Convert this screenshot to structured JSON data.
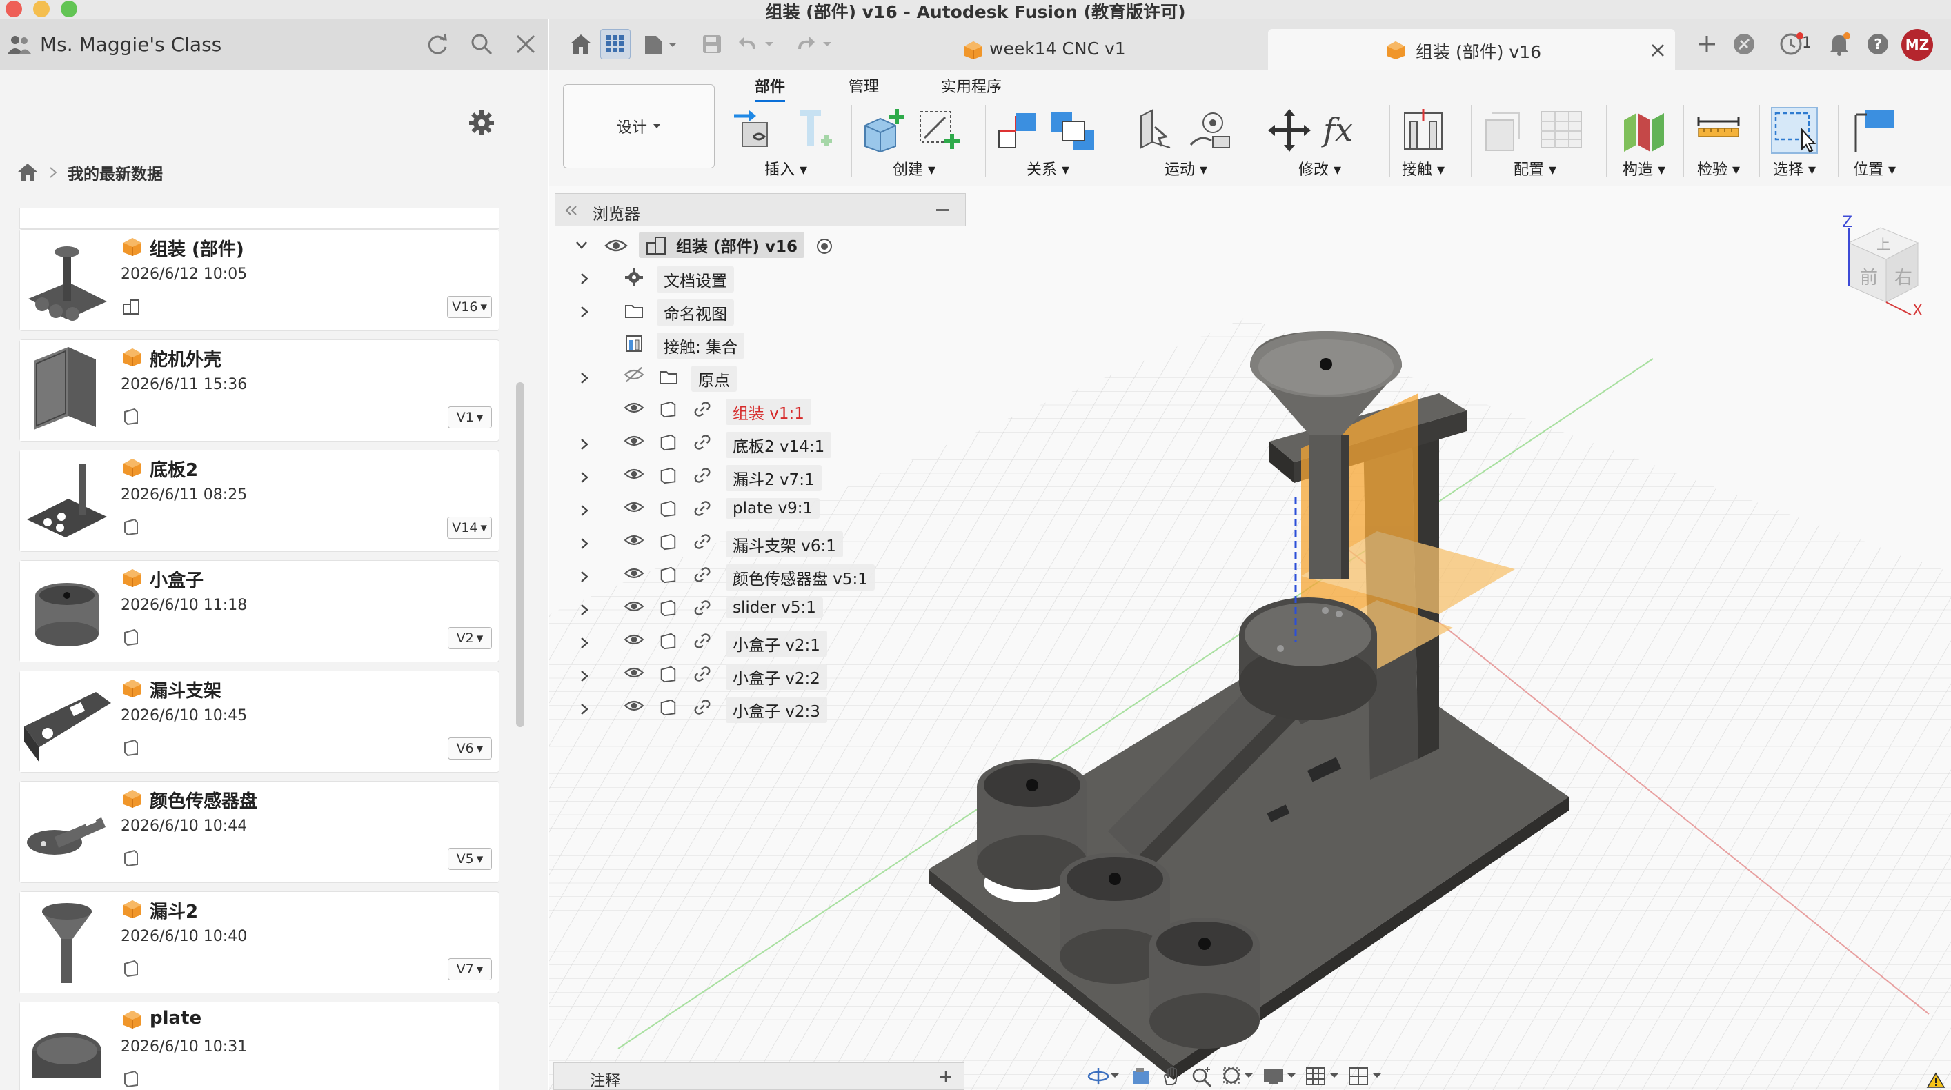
{
  "window": {
    "title": "组装 (部件) v16 - Autodesk Fusion (教育版许可)"
  },
  "data_panel": {
    "team_name": "Ms. Maggie's Class",
    "breadcrumb": "我的最新数据",
    "items": [
      {
        "name": "组装 (部件)",
        "date": "2026/6/12 10:05",
        "version": "V16",
        "type": "assembly",
        "thumb": "assembly"
      },
      {
        "name": "舵机外壳",
        "date": "2026/6/11 15:36",
        "version": "V1",
        "type": "part",
        "thumb": "housing"
      },
      {
        "name": "底板2",
        "date": "2026/6/11 08:25",
        "version": "V14",
        "type": "part",
        "thumb": "baseplate"
      },
      {
        "name": "小盒子",
        "date": "2026/6/10 11:18",
        "version": "V2",
        "type": "part",
        "thumb": "cup"
      },
      {
        "name": "漏斗支架",
        "date": "2026/6/10 10:45",
        "version": "V6",
        "type": "part",
        "thumb": "bracket"
      },
      {
        "name": "颜色传感器盘",
        "date": "2026/6/10 10:44",
        "version": "V5",
        "type": "part",
        "thumb": "sensordisk"
      },
      {
        "name": "漏斗2",
        "date": "2026/6/10 10:40",
        "version": "V7",
        "type": "part",
        "thumb": "funnel"
      },
      {
        "name": "plate",
        "date": "2026/6/10 10:31",
        "version": "",
        "type": "part",
        "thumb": "plate"
      }
    ]
  },
  "tabs": [
    {
      "label": "week14 CNC v1",
      "active": false
    },
    {
      "label": "组装 (部件) v16",
      "active": true
    }
  ],
  "notifications": {
    "job_count": "1"
  },
  "user": {
    "initials": "MZ"
  },
  "toolbar": {
    "workspace": "设计",
    "tabs": [
      "部件",
      "管理",
      "实用程序"
    ],
    "groups": [
      "插入",
      "创建",
      "关系",
      "运动",
      "修改",
      "接触",
      "配置",
      "构造",
      "检验",
      "选择",
      "位置"
    ]
  },
  "browser": {
    "title": "浏览器",
    "root": "组装 (部件) v16",
    "rows": [
      {
        "label": "文档设置",
        "kind": "settings",
        "expand": true
      },
      {
        "label": "命名视图",
        "kind": "folder",
        "expand": true
      },
      {
        "label": "接触: 集合",
        "kind": "contact",
        "expand": false
      },
      {
        "label": "原点",
        "kind": "origin",
        "expand": true
      },
      {
        "label": "组装 v1:1",
        "kind": "ref-red",
        "expand": false
      },
      {
        "label": "底板2 v14:1",
        "kind": "ref",
        "expand": true
      },
      {
        "label": "漏斗2 v7:1",
        "kind": "ref",
        "expand": true
      },
      {
        "label": "plate v9:1",
        "kind": "ref",
        "expand": true
      },
      {
        "label": "漏斗支架 v6:1",
        "kind": "ref",
        "expand": true
      },
      {
        "label": "颜色传感器盘 v5:1",
        "kind": "ref",
        "expand": true
      },
      {
        "label": "slider v5:1",
        "kind": "ref",
        "expand": true
      },
      {
        "label": "小盒子 v2:1",
        "kind": "ref",
        "expand": true
      },
      {
        "label": "小盒子 v2:2",
        "kind": "ref",
        "expand": true
      },
      {
        "label": "小盒子 v2:3",
        "kind": "ref",
        "expand": true
      }
    ]
  },
  "viewcube": {
    "top": "上",
    "front": "前",
    "right": "右",
    "axis_z": "Z",
    "axis_x": "X"
  },
  "comments": {
    "label": "注释"
  },
  "colors": {
    "accent": "#0a6fd8",
    "component_orange": "#f0962a",
    "error_red": "#d62a2a"
  }
}
